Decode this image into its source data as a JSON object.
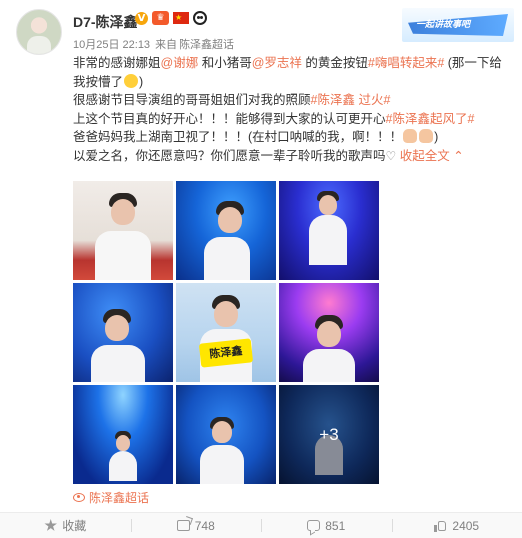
{
  "header": {
    "username": "D7-陈泽鑫",
    "badges": {
      "vip": "V",
      "crown": "♛",
      "flag": "★"
    },
    "timestamp": "10月25日 22:13",
    "source_prefix": "来自",
    "source": "陈泽鑫超话",
    "banner_text": "一起讲故事吧"
  },
  "post": {
    "line1_text": "非常的感谢娜姐",
    "mention1": "@谢娜",
    "line1_mid": " 和小猪哥",
    "mention2": "@罗志祥",
    "line1_after": " 的黄金按钮",
    "hashtag1": "#嗨唱转起来#",
    "line1_end": " (那一下给我按懵了",
    "line1_close": ")",
    "line2_text": "很感谢节目导演组的哥哥姐姐们对我的照顾",
    "hashtag2": "#陈泽鑫 过火#",
    "line3_text": "上这个节目真的好开心！！！能够得到大家的认可更开心",
    "hashtag3": "#陈泽鑫起风了#",
    "line4_text": "爸爸妈妈我上湖南卫视了！！！(在村口呐喊的我，啊！！！",
    "line4_close": ")",
    "line5_text": "以爱之名，你还愿意吗？你们愿意一辈子聆听我的歌声吗",
    "heart": "♡",
    "expand": "收起全文",
    "expand_arrow": "⌃"
  },
  "photos": {
    "count_overlay": "+3",
    "sign_text": "陈泽鑫"
  },
  "topic": {
    "label": "陈泽鑫超话"
  },
  "actions": {
    "favorite": "收藏",
    "share_count": "748",
    "comment_count": "851",
    "like_count": "2405"
  },
  "colors": {
    "link": "#eb7350",
    "text": "#333333",
    "meta": "#808080"
  }
}
